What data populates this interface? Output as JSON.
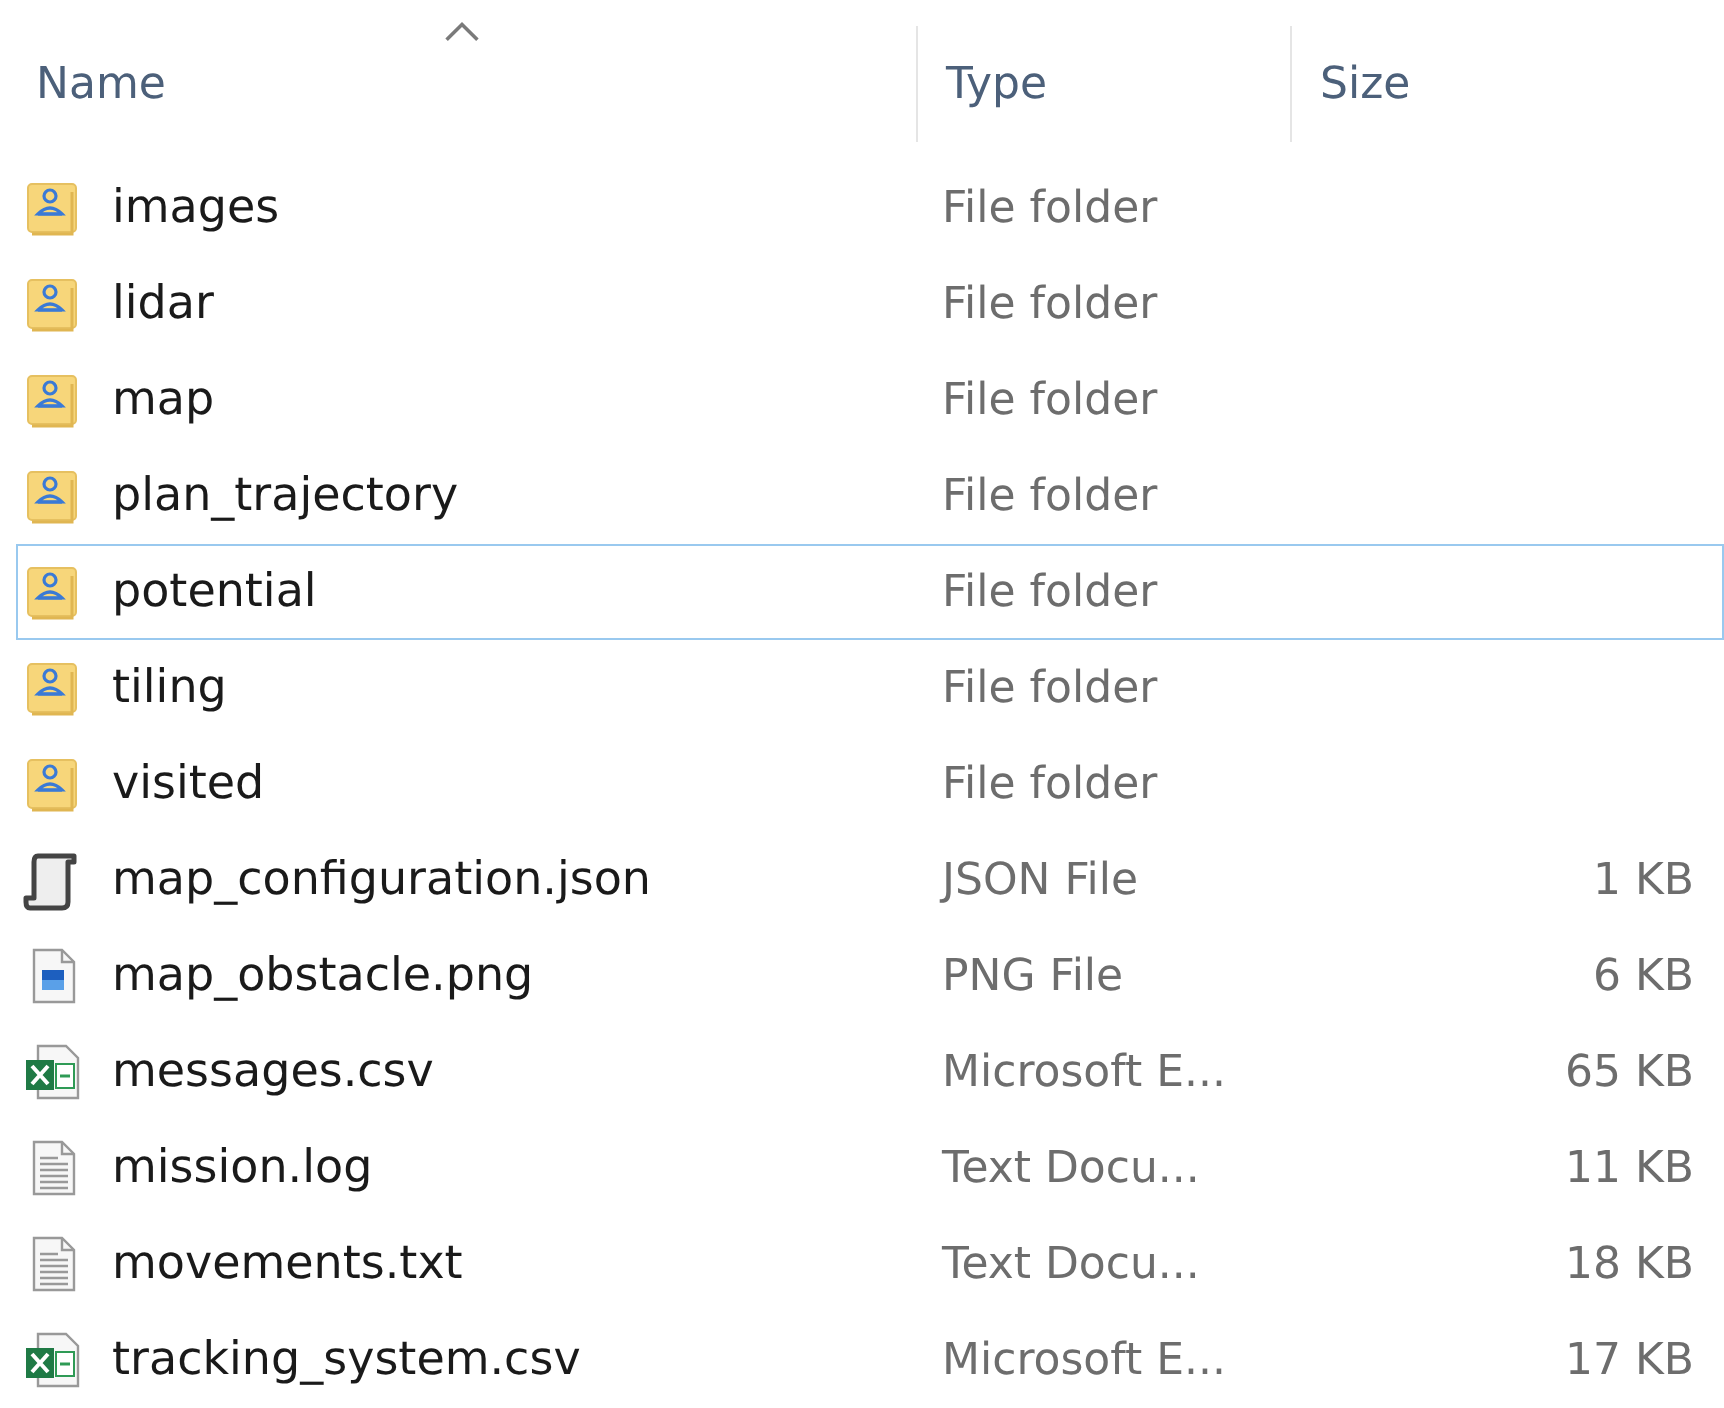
{
  "columns": [
    {
      "label": "Name"
    },
    {
      "label": "Type"
    },
    {
      "label": "Size"
    }
  ],
  "files": [
    {
      "kind": "folder",
      "name": "images",
      "type": "File folder",
      "focused": false
    },
    {
      "kind": "folder",
      "name": "lidar",
      "type": "File folder",
      "focused": false
    },
    {
      "kind": "folder",
      "name": "map",
      "type": "File folder",
      "focused": false
    },
    {
      "kind": "folder",
      "name": "plan_trajectory",
      "type": "File folder",
      "focused": false
    },
    {
      "kind": "folder",
      "name": "potential",
      "type": "File folder",
      "focused": true
    },
    {
      "kind": "folder",
      "name": "tiling",
      "type": "File folder",
      "focused": false
    },
    {
      "kind": "folder",
      "name": "visited",
      "type": "File folder",
      "focused": false
    },
    {
      "kind": "script",
      "name": "map_configuration.json",
      "type": "JSON File",
      "size": "1 KB",
      "focused": false
    },
    {
      "kind": "image",
      "name": "map_obstacle.png",
      "type": "PNG File",
      "size": "6 KB",
      "focused": false
    },
    {
      "kind": "sheet",
      "name": "messages.csv",
      "type": "Microsoft E...",
      "size": "65 KB",
      "focused": false
    },
    {
      "kind": "text",
      "name": "mission.log",
      "type": "Text Docu...",
      "size": "11 KB",
      "focused": false
    },
    {
      "kind": "text",
      "name": "movements.txt",
      "type": "Text Docu...",
      "size": "18 KB",
      "focused": false
    },
    {
      "kind": "sheet",
      "name": "tracking_system.csv",
      "type": "Microsoft E...",
      "size": "17 KB",
      "focused": false
    }
  ]
}
